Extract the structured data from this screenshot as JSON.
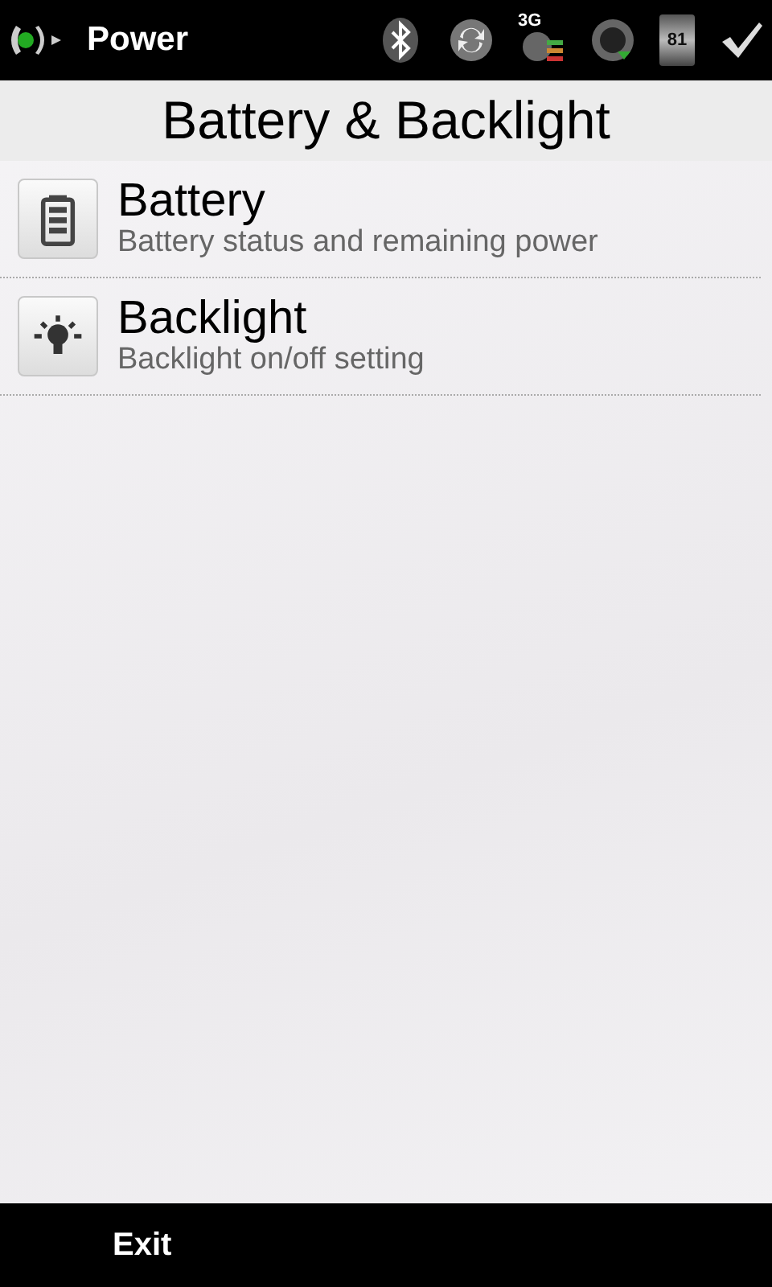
{
  "status_bar": {
    "app_title": "Power",
    "network_label": "3G",
    "battery_label": "81"
  },
  "header": {
    "title": "Battery & Backlight"
  },
  "items": [
    {
      "kind": "battery",
      "title": "Battery",
      "subtitle": "Battery status and remaining power"
    },
    {
      "kind": "backlight",
      "title": "Backlight",
      "subtitle": "Backlight on/off setting"
    }
  ],
  "softkeys": {
    "left": "Exit"
  }
}
